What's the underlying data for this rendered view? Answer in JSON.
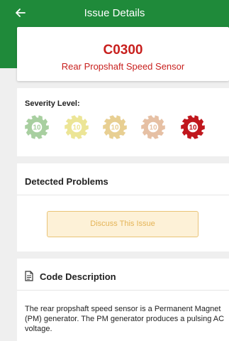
{
  "app_bar": {
    "title": "Issue Details",
    "back_icon": "arrow-left-icon",
    "color": "#1f8a3a"
  },
  "code_card": {
    "code": "C0300",
    "name": "Rear Propshaft Speed Sensor",
    "color": "#c8201e"
  },
  "severity": {
    "label": "Severity Level:",
    "level": 5,
    "max_level": 5,
    "icon": "gear-icon",
    "gears": [
      {
        "text": "10",
        "color": "#a8cfa0",
        "active": false
      },
      {
        "text": "10",
        "color": "#ece596",
        "active": false
      },
      {
        "text": "10",
        "color": "#e8cf92",
        "active": false
      },
      {
        "text": "10",
        "color": "#e6c0a4",
        "active": false
      },
      {
        "text": "10",
        "color": "#c0171d",
        "active": true
      }
    ]
  },
  "problems": {
    "title": "Detected Problems",
    "discuss_button": "Discuss This Issue"
  },
  "description": {
    "icon": "document-icon",
    "title": "Code Description",
    "text": "The rear propshaft speed sensor is a Permanent Magnet (PM) generator. The PM generator produces a pulsing AC voltage."
  }
}
